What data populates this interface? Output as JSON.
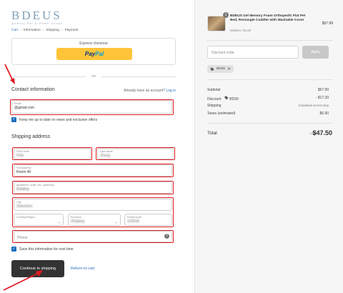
{
  "store": {
    "logo": "BDEUS",
    "tagline": "Quality Pet & Home Goods"
  },
  "breadcrumb": [
    {
      "label": "Cart",
      "link": true
    },
    {
      "label": "Information",
      "link": false
    },
    {
      "label": "Shipping",
      "link": false
    },
    {
      "label": "Payment",
      "link": false
    }
  ],
  "breadcrumb_sep": "›",
  "express": {
    "title": "Express checkout",
    "paypal_pay": "Pay",
    "paypal_pal": "Pal"
  },
  "or_text": "OR",
  "contact": {
    "title": "Contact information",
    "login_prompt": "Already have an account?",
    "login_link": "Log in",
    "email_label": "Email",
    "email_value": "@gmail.com",
    "newsletter_label": "Keep me up to date on news and exclusive offers"
  },
  "shipping": {
    "title": "Shipping address",
    "first_name_label": "First name",
    "first_name_value": "Felix",
    "last_name_label": "Last name",
    "last_name_value": "Zhang",
    "address_label": "Full address",
    "address_value": "Room 40",
    "apartment_label": "Apartment, suite, etc. (optional)",
    "apartment_value": "Building",
    "city_label": "City",
    "city_value": "Shenzhen",
    "country_label": "Country/Region",
    "province_label": "Province",
    "province_value": "Zhejiang",
    "postal_label": "Postal code",
    "postal_value": "310018",
    "phone_placeholder": "Phone",
    "save_info_label": "Save this information for next time"
  },
  "actions": {
    "continue_label": "Continue to shipping",
    "return_label": "Return to cart"
  },
  "order": {
    "quantity": "1",
    "product_name": "BDEUS Gel Memory Foam Orthopedic Flat Pet Bed, Rectangle Cuddler with Washable Cover",
    "product_variant": "Medium / BLUE",
    "product_price": "$57.99",
    "discount_placeholder": "Discount code",
    "apply_label": "Apply",
    "applied_code": "BD30",
    "summary": [
      {
        "label": "Subtotal",
        "value": "$57.99"
      },
      {
        "label": "Discount",
        "code": "BD30",
        "value": "- $17.39"
      },
      {
        "label": "Shipping",
        "value": "Calculated at next step"
      },
      {
        "label": "Taxes (estimated)",
        "value": "$6.90"
      }
    ],
    "total_label": "Total",
    "total_currency": "USD",
    "total_value": "$47.50"
  },
  "colors": {
    "highlight_box": "#e11b22",
    "link": "#2a6ebb",
    "paypal": "#ffc439",
    "button_dark": "#333333"
  },
  "icons": {
    "checkbox": "check-icon",
    "tag": "tag-icon",
    "remove": "close-icon",
    "help": "question-icon",
    "chevron": "chevron-down-icon"
  }
}
